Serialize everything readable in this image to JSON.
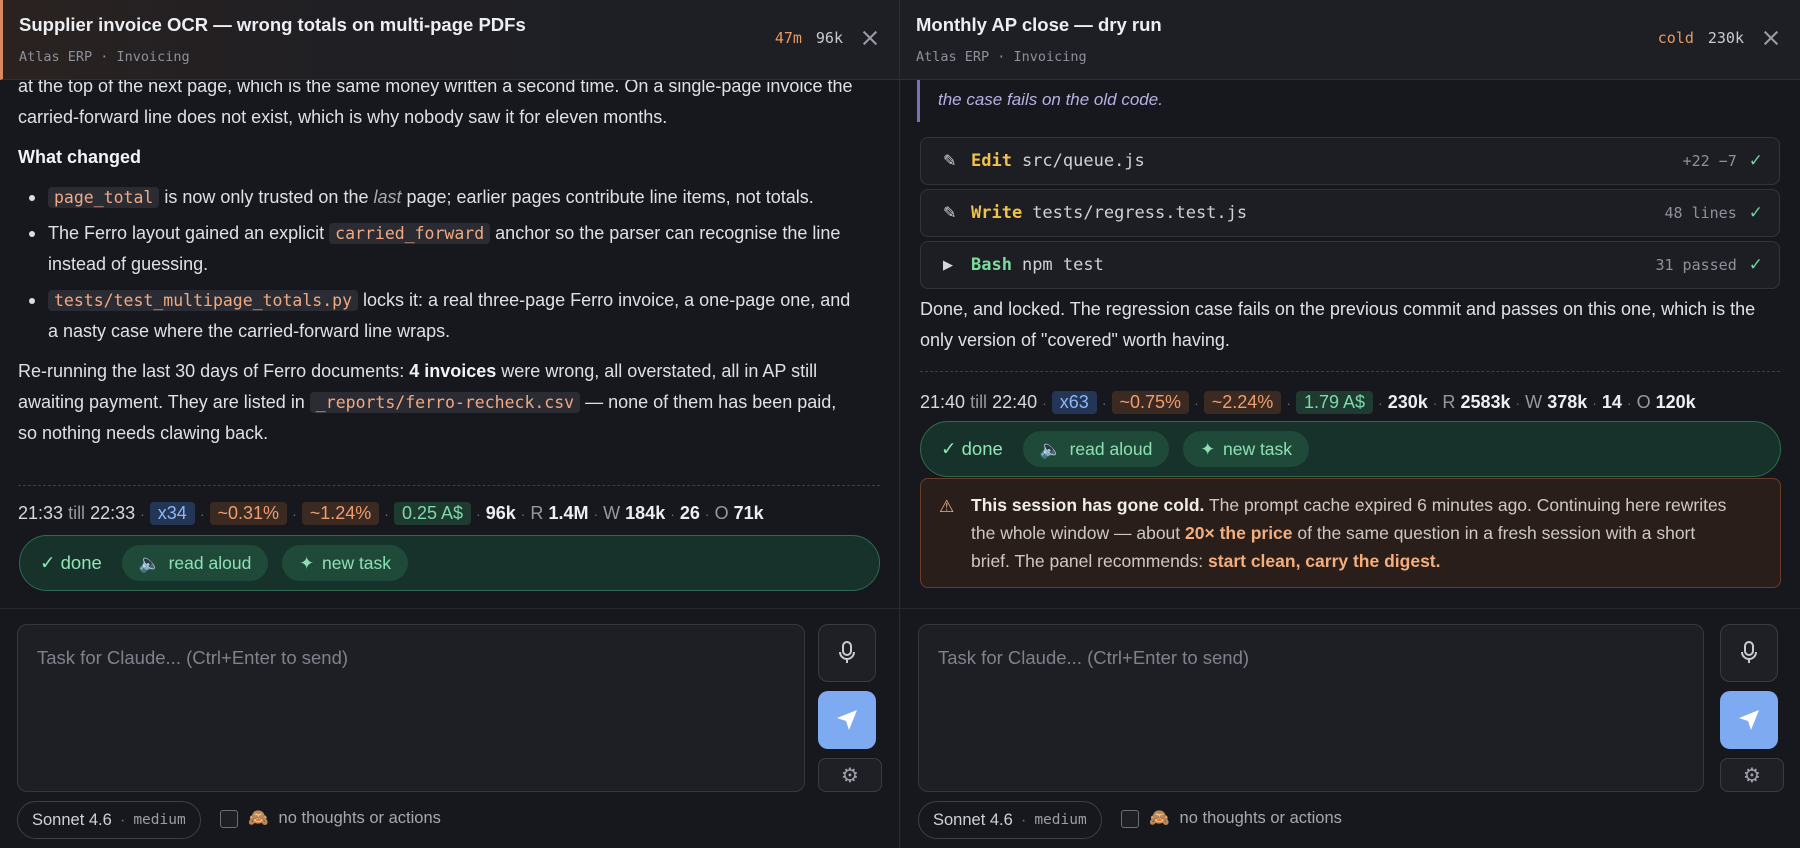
{
  "left": {
    "header": {
      "title": "Supplier invoice OCR — wrong totals on multi-page PDFs",
      "crumb": "Atlas ERP · Invoicing",
      "age": "47m",
      "tokens": "96k"
    },
    "para1_a": "at the top of the next page, which is the same money written a second time. On a single-page invoice the",
    "para1_b": "carried-forward line does not exist, which is why nobody saw it for eleven months.",
    "heading": "What changed",
    "b1_code": "page_total",
    "b1_t1": " is now only trusted on the ",
    "b1_em": "last",
    "b1_t2": " page; earlier pages contribute line items, not totals.",
    "b2_t1": "The Ferro layout gained an explicit ",
    "b2_code": "carried_forward",
    "b2_t2": " anchor so the parser can recognise the line",
    "b2_t3": "instead of guessing.",
    "b3_code": "tests/test_multipage_totals.py",
    "b3_t1": " locks it: a real three-page Ferro invoice, a one-page one, and",
    "b3_t2": "a nasty case where the carried-forward line wraps.",
    "p2_t1": "Re-running the last 30 days of Ferro documents: ",
    "p2_b": "4 invoices",
    "p2_t2": " were wrong, all overstated, all in AP still",
    "p2_t3": "awaiting payment. They are listed in ",
    "p2_code": "_reports/ferro-recheck.csv",
    "p2_t4": " — none of them has been paid,",
    "p2_t5": "so nothing needs clawing back.",
    "meta": {
      "start": "21:33",
      "till": "till",
      "end": "22:33",
      "mult": "x34",
      "pct1": "~0.31%",
      "pct2": "~1.24%",
      "cost": "0.25 A$",
      "tok": "96k",
      "r_label": "R",
      "r": "1.4M",
      "w_label": "W",
      "w": "184k",
      "n": "26",
      "o_label": "O",
      "o": "71k"
    },
    "done": {
      "label": "✓ done",
      "read": "read aloud",
      "new": "new task"
    }
  },
  "right": {
    "header": {
      "title": "Monthly AP close — dry run",
      "crumb": "Atlas ERP · Invoicing",
      "age": "cold",
      "tokens": "230k"
    },
    "quote_tail": "the case fails on the old code.",
    "tools": [
      {
        "icon": "✎",
        "verb": "Edit",
        "arg": "src/queue.js",
        "result": "+22 −7"
      },
      {
        "icon": "✎",
        "verb": "Write",
        "arg": "tests/regress.test.js",
        "result": "48 lines"
      },
      {
        "icon": "▶",
        "verb": "Bash",
        "arg": "npm test",
        "result": "31 passed"
      }
    ],
    "check": "✓",
    "para_a": "Done, and locked. The regression case fails on the previous commit and passes on this one, which is the",
    "para_b": "only version of \"covered\" worth having.",
    "meta": {
      "start": "21:40",
      "till": "till",
      "end": "22:40",
      "mult": "x63",
      "pct1": "~0.75%",
      "pct2": "~2.24%",
      "cost": "1.79 A$",
      "tok": "230k",
      "r_label": "R",
      "r": "2583k",
      "w_label": "W",
      "w": "378k",
      "n": "14",
      "o_label": "O",
      "o": "120k"
    },
    "done": {
      "label": "✓ done",
      "read": "read aloud",
      "new": "new task"
    },
    "warning": {
      "lead": "This session has gone cold.",
      "t1": " The prompt cache expired 6 minutes ago. Continuing here rewrites",
      "t2": "the whole window — about ",
      "price": "20× the price",
      "t3": " of the same question in a fresh session with a short",
      "t4": "brief. The panel recommends: ",
      "rec": "start clean, carry the digest."
    }
  },
  "composer": {
    "placeholder": "Task for Claude...  (Ctrl+Enter to send)",
    "model": "Sonnet 4.6",
    "effort": "medium",
    "thoughts": "no thoughts or actions"
  },
  "colors": {
    "accent": "#e59b63",
    "send": "#7eaaf2",
    "done": "#8ee7b5",
    "warn_border": "#6b3d28"
  }
}
